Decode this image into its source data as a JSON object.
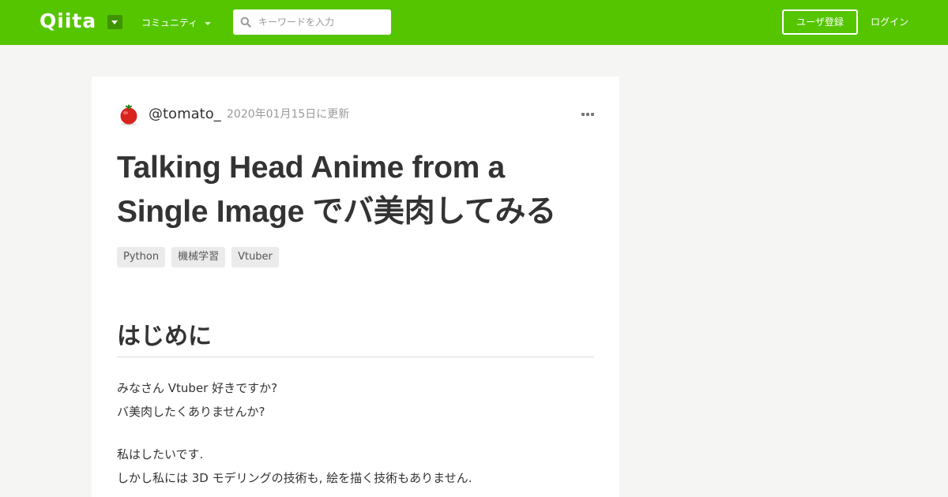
{
  "header": {
    "logo_text": "Qiita",
    "community_label": "コミュニティ",
    "search_placeholder": "キーワードを入力",
    "signup_label": "ユーザ登録",
    "login_label": "ログイン",
    "brand_color": "#55c500"
  },
  "article": {
    "author": "@tomato_",
    "updated": "2020年01月15日に更新",
    "title_line1": "Talking Head Anime from a",
    "title_line2": "Single Image でバ美肉してみる",
    "tags": [
      "Python",
      "機械学習",
      "Vtuber"
    ],
    "section_heading": "はじめに",
    "para1_lines": [
      "みなさん Vtuber 好きですか?",
      "バ美肉したくありませんか?"
    ],
    "para2_lines": [
      "私はしたいです.",
      "しかし私には 3D モデリングの技術も, 絵を描く技術もありません."
    ]
  }
}
